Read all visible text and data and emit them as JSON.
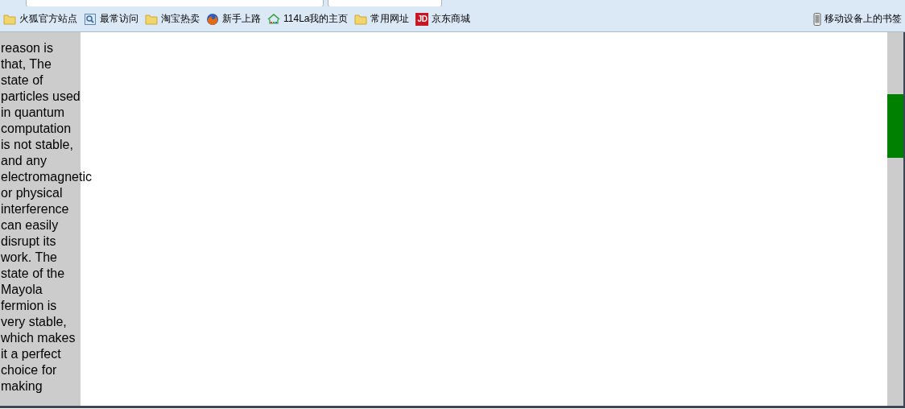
{
  "bookmarks": [
    {
      "kind": "folder",
      "label": "火狐官方站点"
    },
    {
      "kind": "page",
      "label": "最常访问"
    },
    {
      "kind": "folder",
      "label": "淘宝热卖"
    },
    {
      "kind": "firefox",
      "label": "新手上路"
    },
    {
      "kind": "house",
      "label": "114La我的主页"
    },
    {
      "kind": "folder",
      "label": "常用网址"
    },
    {
      "kind": "badge",
      "icon_text": "JD",
      "label": "京东商城"
    }
  ],
  "mobile_bookmarks": {
    "label": "移动设备上的书签"
  },
  "sidebar": {
    "lines": [
      "reason is",
      "that, The",
      "state of",
      "particles used",
      "in quantum",
      "computation",
      "is not stable,",
      "and any",
      "electromagnetic",
      "or physical",
      "interference",
      "can easily",
      "disrupt its",
      "work. The",
      "state of the",
      "Mayola",
      "fermion is",
      "very stable,",
      "which makes",
      "it a perfect",
      "choice for",
      "making"
    ]
  }
}
